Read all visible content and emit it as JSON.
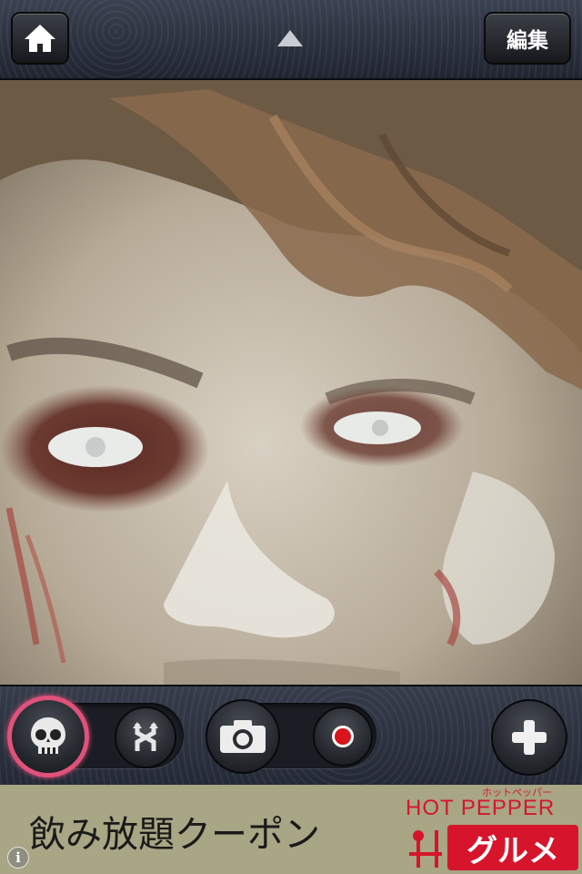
{
  "header": {
    "home_icon": "home-icon",
    "expand_icon": "triangle-up-icon",
    "edit_label": "編集"
  },
  "photo": {
    "subject": "zombie-face"
  },
  "toolbar": {
    "skull_icon": "skull-icon",
    "swap_icon": "swap-arrows-icon",
    "camera_icon": "camera-icon",
    "record_icon": "record-icon",
    "add_icon": "plus-icon",
    "active_color": "#e0527a"
  },
  "ad": {
    "text": "飲み放題クーポン",
    "brand_kana": "ホットペッパー",
    "brand_title": "HOT PEPPER",
    "brand_sub": "グルメ",
    "brand_color": "#d6152c",
    "info_label": "i"
  }
}
